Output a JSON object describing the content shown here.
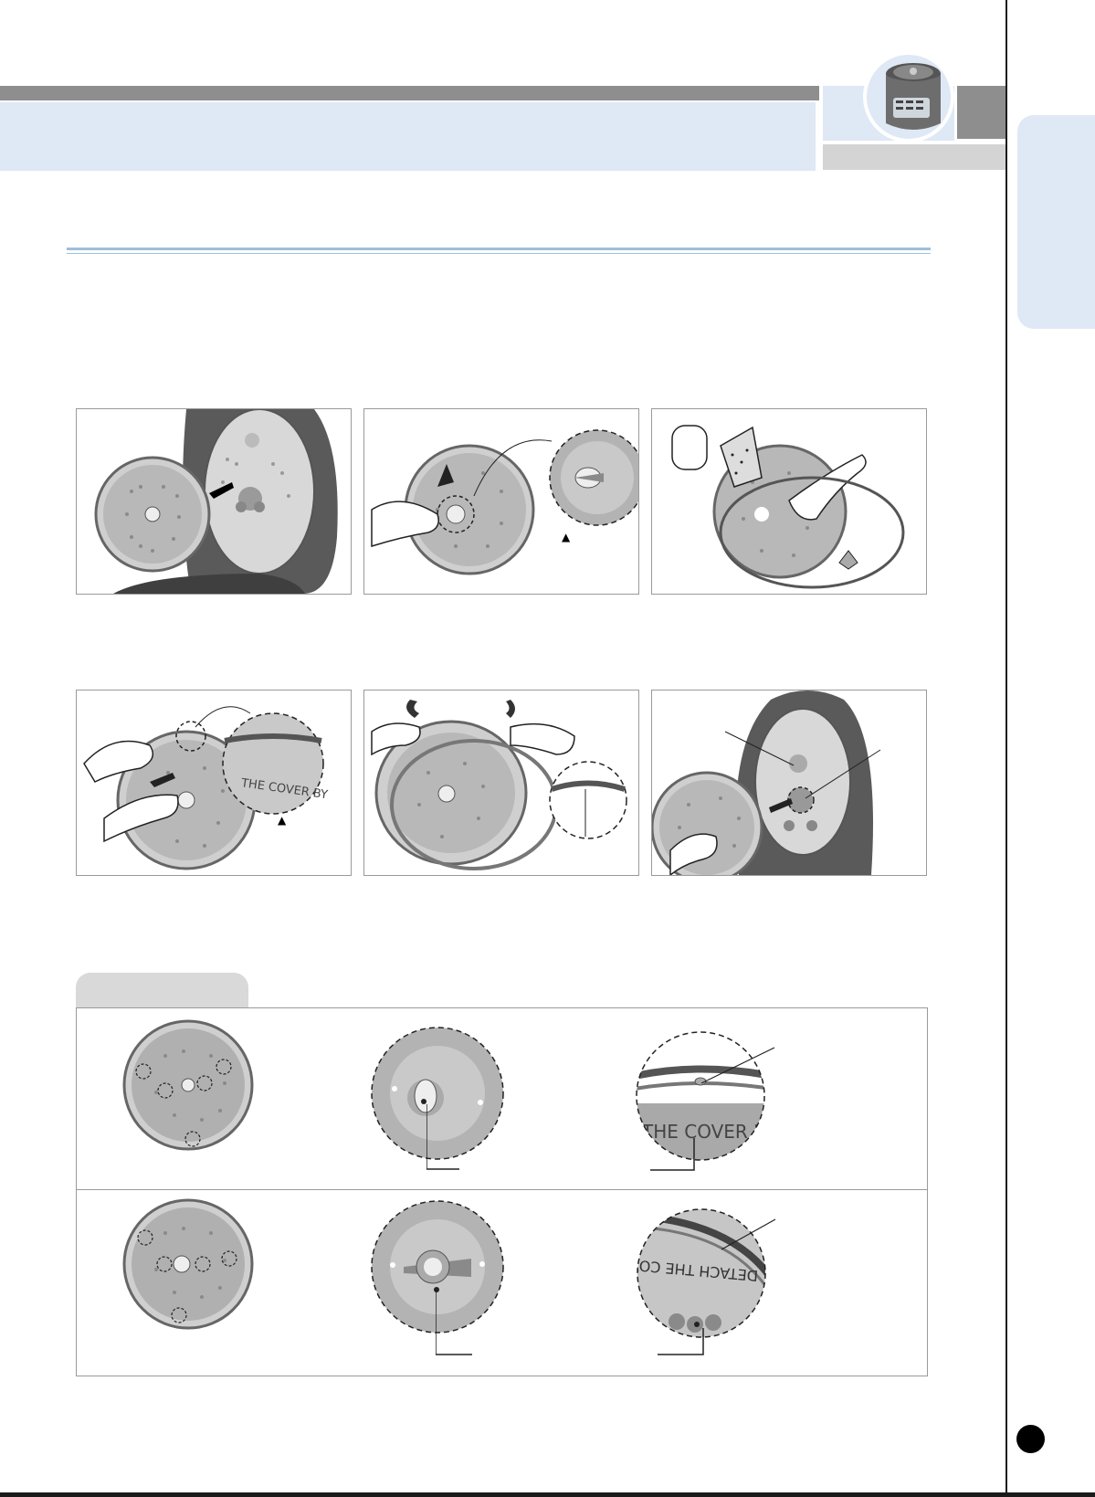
{
  "header": {
    "bar_color": "#8e8e8e",
    "band_color": "#dfe8f5",
    "thumbnail_icon": "rice-cooker-icon"
  },
  "steps": [
    {
      "id": 1,
      "illustration": "detach-inner-lid-from-cooker"
    },
    {
      "id": 2,
      "illustration": "turn-center-knob-on-inner-lid"
    },
    {
      "id": 3,
      "illustration": "wash-inner-lid-with-sponge"
    },
    {
      "id": 4,
      "illustration": "remove-rubber-packing-from-lid"
    },
    {
      "id": 5,
      "illustration": "reattach-rubber-packing-ring"
    },
    {
      "id": 6,
      "illustration": "reattach-inner-lid-to-cooker"
    }
  ],
  "detail_marks": {
    "zoom_arrow": "▲"
  },
  "reference_table": {
    "rows": [
      {
        "items": [
          "inner-lid-front-icon",
          "center-knob-detached-icon",
          "packing-edge-detail-icon"
        ]
      },
      {
        "items": [
          "inner-lid-back-icon",
          "center-knob-attached-icon",
          "packing-groove-detail-icon"
        ]
      }
    ]
  },
  "zoom_text": {
    "cover_text_1": "THE COVER BY PULLI",
    "cover_text_2": "THE COVER BY",
    "cover_text_3": "DETACH THE COVER BY"
  }
}
